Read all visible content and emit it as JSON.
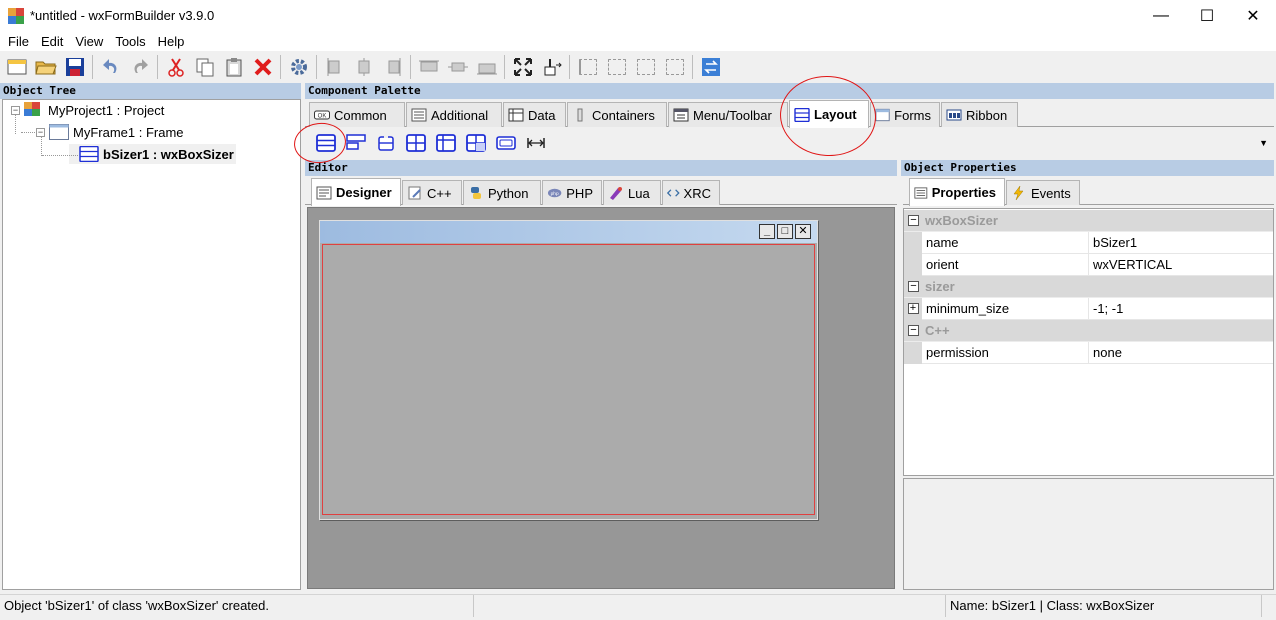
{
  "window": {
    "title": "*untitled - wxFormBuilder v3.9.0",
    "minimize": "—",
    "maximize": "☐",
    "close": "✕"
  },
  "menu": [
    "File",
    "Edit",
    "View",
    "Tools",
    "Help"
  ],
  "panels": {
    "object_tree": "Object Tree",
    "component_palette": "Component Palette",
    "editor": "Editor",
    "object_properties": "Object Properties"
  },
  "tree": {
    "project": "MyProject1 : Project",
    "frame": "MyFrame1 : Frame",
    "sizer": "bSizer1 : wxBoxSizer"
  },
  "palette_tabs": [
    "Common",
    "Additional",
    "Data",
    "Containers",
    "Menu/Toolbar",
    "Layout",
    "Forms",
    "Ribbon"
  ],
  "editor_tabs": [
    "Designer",
    "C++",
    "Python",
    "PHP",
    "Lua",
    "XRC"
  ],
  "props_tabs": [
    "Properties",
    "Events"
  ],
  "properties": {
    "categories": [
      "wxBoxSizer",
      "sizer",
      "C++"
    ],
    "rows": [
      {
        "name": "name",
        "value": "bSizer1"
      },
      {
        "name": "orient",
        "value": "wxVERTICAL"
      },
      {
        "name": "minimum_size",
        "value": "-1; -1"
      },
      {
        "name": "permission",
        "value": "none"
      }
    ]
  },
  "status": {
    "message": "Object 'bSizer1' of class 'wxBoxSizer' created.",
    "selection": "Name: bSizer1 | Class: wxBoxSizer"
  },
  "colors": {
    "panel_header": "#b8cce4",
    "annotation": "#e01515",
    "canvas": "#979797",
    "icon_blue": "#1f2fd6"
  }
}
